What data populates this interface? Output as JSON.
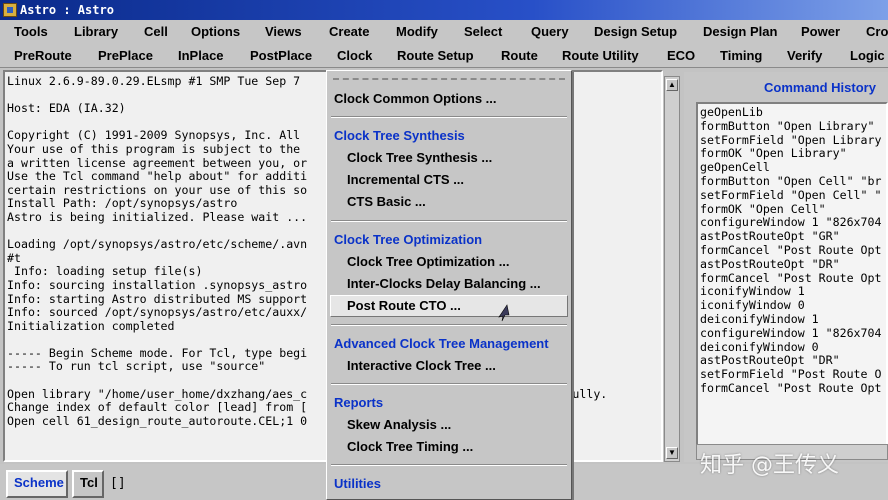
{
  "window": {
    "title": "Astro : Astro"
  },
  "menubar1": [
    "Tools",
    "Library",
    "Cell",
    "Options",
    "Views",
    "Create",
    "Modify",
    "Select",
    "Query",
    "Design Setup",
    "Design Plan",
    "Power",
    "Cro"
  ],
  "menubar2": [
    "PreRoute",
    "PrePlace",
    "InPlace",
    "PostPlace",
    "Clock",
    "Route Setup",
    "Route",
    "Route Utility",
    "ECO",
    "Timing",
    "Verify",
    "Logic"
  ],
  "console": {
    "lines": [
      "Linux 2.6.9-89.0.29.ELsmp #1 SMP Tue Sep 7",
      "",
      "Host: EDA (IA.32)",
      "",
      "Copyright (C) 1991-2009 Synopsys, Inc. All",
      "Your use of this program is subject to the",
      "a written license agreement between you, or",
      "Use the Tcl command \"help about\" for additi",
      "certain restrictions on your use of this so",
      "Install Path: /opt/synopsys/astro",
      "Astro is being initialized. Please wait ...",
      "",
      "Loading /opt/synopsys/astro/etc/scheme/.avn",
      "#t",
      " Info: loading setup file(s)",
      "Info: sourcing installation .synopsys_astro",
      "Info: starting Astro distributed MS support",
      "Info: sourced /opt/synopsys/astro/etc/auxx/",
      "Initialization completed",
      "",
      "----- Begin Scheme mode. For Tcl, type begi",
      "----- To run tcl script, use \"source\"",
      "",
      "Open library \"/home/user_home/dxzhang/aes_c                                ccessfully.",
      "Change index of default color [lead] from [",
      "Open cell 61_design_route_autoroute.CEL;1 0"
    ]
  },
  "history": {
    "title": "Command History",
    "lines": [
      "geOpenLib",
      "formButton \"Open Library\"",
      "setFormField \"Open Library",
      "formOK \"Open Library\"",
      "geOpenCell",
      "formButton \"Open Cell\" \"br",
      "setFormField \"Open Cell\" \"",
      "formOK \"Open Cell\"",
      "configureWindow 1 \"826x704",
      "astPostRouteOpt \"GR\"",
      "formCancel \"Post Route Opt",
      "astPostRouteOpt \"DR\"",
      "formCancel \"Post Route Opt",
      "iconifyWindow 1",
      "iconifyWindow 0",
      "deiconifyWindow 1",
      "configureWindow 1 \"826x704",
      "deiconifyWindow 0",
      "astPostRouteOpt \"DR\"",
      "setFormField \"Post Route O",
      "formCancel \"Post Route Opt"
    ]
  },
  "clock_menu": {
    "common_options": "Clock Common Options ...",
    "section_cts": "Clock Tree Synthesis",
    "cts_synthesis": "Clock Tree Synthesis ...",
    "incremental_cts": "Incremental CTS ...",
    "cts_basic": "CTS Basic ...",
    "section_opt": "Clock Tree Optimization",
    "cto": "Clock Tree Optimization ...",
    "inter_clock": "Inter-Clocks Delay Balancing ...",
    "post_route_cto": "Post Route CTO ...",
    "section_adv": "Advanced Clock Tree Management",
    "interactive": "Interactive Clock Tree ...",
    "section_reports": "Reports",
    "skew": "Skew Analysis ...",
    "timing": "Clock Tree Timing ...",
    "section_utilities": "Utilities"
  },
  "bottom": {
    "tab_scheme": "Scheme",
    "tab_tcl": "Tcl",
    "cursor": "[]"
  },
  "watermark": "知乎 @王传义",
  "colors": {
    "accent_blue": "#0a32c8",
    "menu_bg": "#c6c6c6",
    "title_bar": "#0a2a8a"
  }
}
